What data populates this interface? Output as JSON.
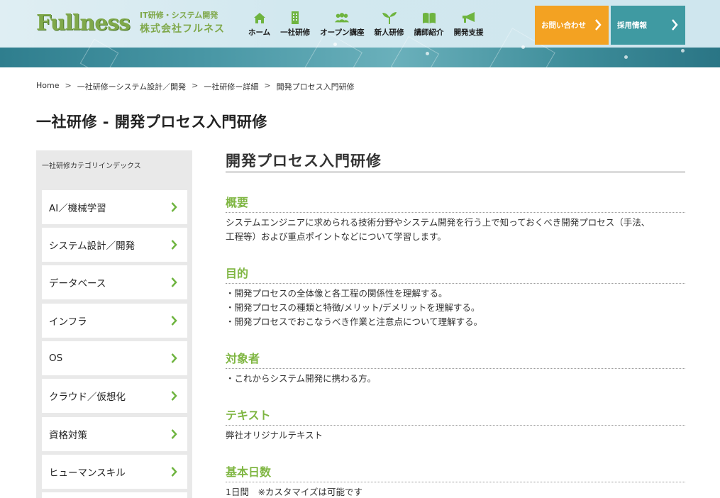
{
  "header": {
    "logo_text": "Fullness",
    "tagline": "IT研修・システム開発",
    "company": "株式会社フルネス",
    "nav": [
      {
        "label": "ホーム",
        "icon": "home-icon"
      },
      {
        "label": "一社研修",
        "icon": "building-icon"
      },
      {
        "label": "オープン講座",
        "icon": "people-icon"
      },
      {
        "label": "新人研修",
        "icon": "sprout-icon"
      },
      {
        "label": "講師紹介",
        "icon": "book-icon"
      },
      {
        "label": "開発支援",
        "icon": "megaphone-icon"
      }
    ],
    "contact_label": "お問い合わせ",
    "recruit_label": "採用情報",
    "accent_orange": "#f3a222",
    "accent_teal": "#3f9aa2"
  },
  "breadcrumb": {
    "items": [
      "Home",
      "一社研修ーシステム設計／開発",
      "一社研修ー詳細",
      "開発プロセス入門研修"
    ],
    "separator": ">"
  },
  "page_title": "一社研修 - 開発プロセス入門研修",
  "sidebar": {
    "title": "一社研修カテゴリインデックス",
    "items": [
      "AI／機械学習",
      "システム設計／開発",
      "データベース",
      "インフラ",
      "OS",
      "クラウド／仮想化",
      "資格対策",
      "ヒューマンスキル"
    ]
  },
  "main": {
    "title": "開発プロセス入門研修",
    "sections": [
      {
        "heading": "概要",
        "lines": [
          "システムエンジニアに求められる技術分野やシステム開発を行う上で知っておくべき開発プロセス（手法、",
          "工程等）および重点ポイントなどについて学習します。"
        ]
      },
      {
        "heading": "目的",
        "lines": [
          "・開発プロセスの全体像と各工程の関係性を理解する。",
          "・開発プロセスの種類と特徴/メリット/デメリットを理解する。",
          "・開発プロセスでおこなうべき作業と注意点について理解する。"
        ]
      },
      {
        "heading": "対象者",
        "lines": [
          "・これからシステム開発に携わる方。"
        ]
      },
      {
        "heading": "テキスト",
        "lines": [
          "弊社オリジナルテキスト"
        ]
      },
      {
        "heading": "基本日数",
        "lines": [
          "1日間　※カスタマイズは可能です"
        ]
      }
    ],
    "heading_color": "#7fb642"
  }
}
